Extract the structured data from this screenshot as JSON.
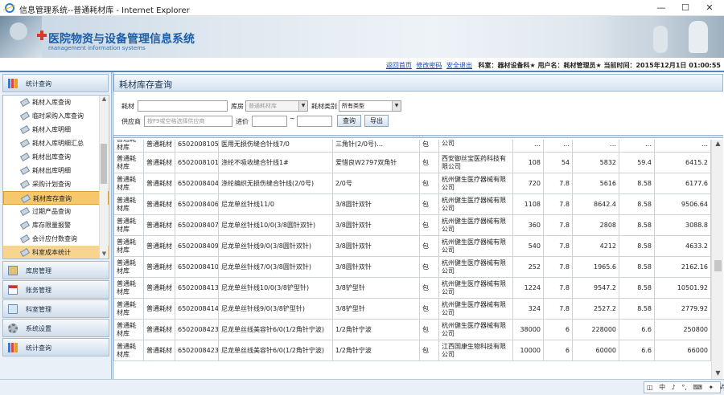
{
  "window": {
    "title": "信息管理系统--普通耗材库 - Internet Explorer",
    "minimize": "—",
    "maximize": "☐",
    "close": "✕"
  },
  "banner": {
    "system_name": "医院物资与设备管理信息系统",
    "subtitle": "management information systems"
  },
  "statusbar": {
    "home_link": "返回首页",
    "change_pwd_link": "修改密码",
    "logout_link": "安全退出",
    "info": "科室：器材设备科★ 用户名：耗材管理员★ 当前时间：2015年12月1日 01:00:55"
  },
  "sidebar": {
    "top_section": "统计查询",
    "items": [
      {
        "label": "耗材入库查询"
      },
      {
        "label": "临时采购入库查询"
      },
      {
        "label": "耗材入库明细"
      },
      {
        "label": "耗材入库明细汇总"
      },
      {
        "label": "耗材出库查询"
      },
      {
        "label": "耗材出库明细"
      },
      {
        "label": "采购计划查询"
      },
      {
        "label": "耗材库存查询"
      },
      {
        "label": "过期产品查询"
      },
      {
        "label": "库存限量报警"
      },
      {
        "label": "会计应付数查询"
      },
      {
        "label": "科室成本统计"
      }
    ],
    "active_index": 7,
    "sections": [
      {
        "label": "库房管理",
        "icon": "warehouse-icon"
      },
      {
        "label": "账务管理",
        "icon": "ledger-icon"
      },
      {
        "label": "科室管理",
        "icon": "department-icon"
      },
      {
        "label": "系统设置",
        "icon": "gear-icon"
      },
      {
        "label": "统计查询",
        "icon": "chart-icon"
      }
    ]
  },
  "main": {
    "panel_title": "耗材库存查询",
    "filters": {
      "material_label": "耗材",
      "material_value": "",
      "warehouse_label": "库房",
      "warehouse_value": "普通耗材库",
      "category_label": "耗材类别",
      "category_value": "所有类型",
      "supplier_label": "供应商",
      "supplier_placeholder": "按F9或空格选择供应商",
      "price_label": "进价",
      "price_from": "",
      "price_sep": "~",
      "price_to": "",
      "search_button": "查询",
      "export_button": "导出"
    },
    "rows": [
      [
        "普通耗材库",
        "普通耗材",
        "6502008105",
        "医用无损伤缝合针线7/0",
        "三角针(2/0号)…",
        "包",
        "公司",
        "…",
        "…",
        "…",
        "…",
        "…"
      ],
      [
        "普通耗材库",
        "普通耗材",
        "6502008101",
        "涤纶不吸收缝合针线1#",
        "爱惜良W2797双角针",
        "包",
        "西安御丝宝医药科技有限公司",
        "108",
        "54",
        "5832",
        "59.4",
        "6415.2"
      ],
      [
        "普通耗材库",
        "普通耗材",
        "6502008404",
        "涤纶编织无损伤缝合针线(2/0号)",
        "2/0号",
        "包",
        "杭州健生医疗器械有限公司",
        "720",
        "7.8",
        "5616",
        "8.58",
        "6177.6"
      ],
      [
        "普通耗材库",
        "普通耗材",
        "6502008406",
        "尼龙单丝针线11/0",
        "3/8圆针双针",
        "包",
        "杭州健生医疗器械有限公司",
        "1108",
        "7.8",
        "8642.4",
        "8.58",
        "9506.64"
      ],
      [
        "普通耗材库",
        "普通耗材",
        "6502008407",
        "尼龙单丝针线10/0(3/8圆针双针)",
        "3/8圆针双针",
        "包",
        "杭州健生医疗器械有限公司",
        "360",
        "7.8",
        "2808",
        "8.58",
        "3088.8"
      ],
      [
        "普通耗材库",
        "普通耗材",
        "6502008409",
        "尼龙单丝针线9/0(3/8圆针双针)",
        "3/8圆针双针",
        "包",
        "杭州健生医疗器械有限公司",
        "540",
        "7.8",
        "4212",
        "8.58",
        "4633.2"
      ],
      [
        "普通耗材库",
        "普通耗材",
        "6502008410",
        "尼龙单丝针线7/0(3/8圆针双针)",
        "3/8圆针双针",
        "包",
        "杭州健生医疗器械有限公司",
        "252",
        "7.8",
        "1965.6",
        "8.58",
        "2162.16"
      ],
      [
        "普通耗材库",
        "普通耗材",
        "6502008413",
        "尼龙单丝针线10/0(3/8铲型针)",
        "3/8铲型针",
        "包",
        "杭州健生医疗器械有限公司",
        "1224",
        "7.8",
        "9547.2",
        "8.58",
        "10501.92"
      ],
      [
        "普通耗材库",
        "普通耗材",
        "6502008414",
        "尼龙单丝针线9/0(3/8铲型针)",
        "3/8铲型针",
        "包",
        "杭州健生医疗器械有限公司",
        "324",
        "7.8",
        "2527.2",
        "8.58",
        "2779.92"
      ],
      [
        "普通耗材库",
        "普通耗材",
        "6502008423",
        "尼龙单丝线美容针6/0(1/2角针宁波)",
        "1/2角针宁波",
        "包",
        "杭州健生医疗器械有限公司",
        "38000",
        "6",
        "228000",
        "6.6",
        "250800"
      ],
      [
        "普通耗材库",
        "普通耗材",
        "6502008423",
        "尼龙单丝线美容针6/0(1/2角针宁波)",
        "1/2角针宁波",
        "包",
        "江西国康生物科技有限公司",
        "10000",
        "6",
        "60000",
        "6.6",
        "66000"
      ]
    ]
  },
  "ime": {
    "items": [
      "中",
      "♪",
      "°,",
      "⌨",
      "✦",
      "⁂"
    ]
  },
  "colors": {
    "accent": "#4f87c1",
    "active_menu": "#f7c86a",
    "brand_text": "#1d5ea8"
  }
}
